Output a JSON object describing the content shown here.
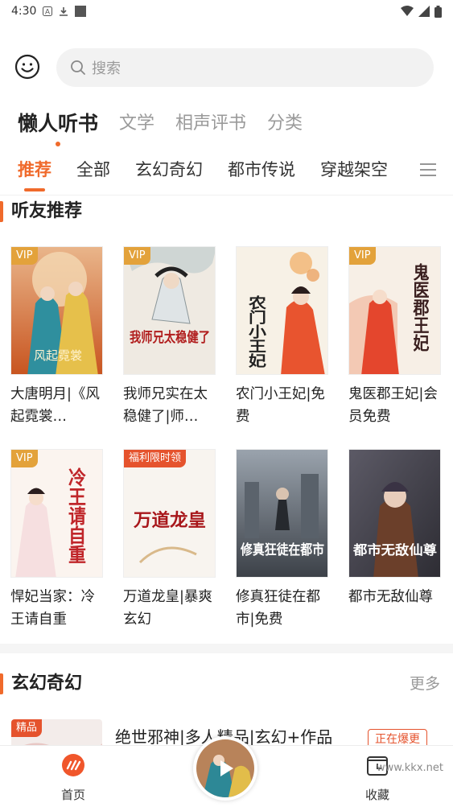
{
  "status_bar": {
    "time": "4:30",
    "left_icons": [
      "a-notification-icon",
      "download-icon",
      "square-icon"
    ],
    "right_icons": [
      "wifi-icon",
      "signal-icon",
      "battery-icon"
    ]
  },
  "search": {
    "placeholder": "搜索"
  },
  "top_tabs": [
    {
      "label": "懒人听书",
      "active": true
    },
    {
      "label": "文学",
      "active": false
    },
    {
      "label": "相声评书",
      "active": false
    },
    {
      "label": "分类",
      "active": false
    }
  ],
  "category_tabs": [
    {
      "label": "推荐",
      "active": true
    },
    {
      "label": "全部",
      "active": false
    },
    {
      "label": "玄幻奇幻",
      "active": false
    },
    {
      "label": "都市传说",
      "active": false
    },
    {
      "label": "穿越架空",
      "active": false
    }
  ],
  "section_friends": {
    "title": "听友推荐"
  },
  "books": [
    {
      "title": "大唐明月|《风起霓裳…",
      "badge": "VIP"
    },
    {
      "title": "我师兄实在太稳健了|师…",
      "badge": "VIP"
    },
    {
      "title": "农门小王妃|免费",
      "badge": ""
    },
    {
      "title": "鬼医郡王妃|会员免费",
      "badge": "VIP"
    },
    {
      "title": "悍妃当家：冷王请自重",
      "badge": "VIP"
    },
    {
      "title": "万道龙皇|暴爽玄幻",
      "badge": "福利限时领"
    },
    {
      "title": "修真狂徒在都市|免费",
      "badge": ""
    },
    {
      "title": "都市无敌仙尊",
      "badge": ""
    }
  ],
  "cover_texts": [
    "风起霓裳",
    "我师兄太稳健了",
    "农门小王妃",
    "鬼医郡王妃",
    "冷王请自重",
    "万道龙皇",
    "修真狂徒在都市",
    "都市无敌仙尊"
  ],
  "section_fantasy": {
    "title": "玄幻奇幻",
    "more": "更多"
  },
  "partial_item": {
    "badge": "精品",
    "title": "绝世邪神|多人精品|玄幻+作品",
    "tag": "正在爆更"
  },
  "bottom_nav": {
    "home": "首页",
    "favorites": "收藏"
  },
  "watermark": "www.kkx.net",
  "colors": {
    "accent": "#f06a2b",
    "vip_badge": "#e3a23b",
    "promo_badge": "#e5532d"
  }
}
